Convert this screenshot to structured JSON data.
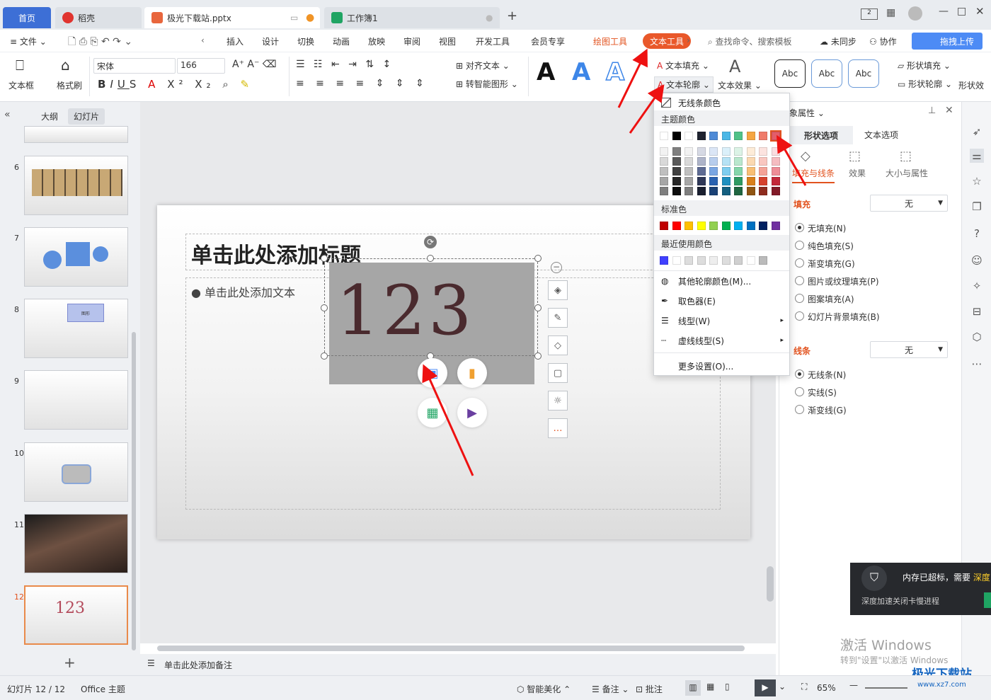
{
  "tabs": {
    "home": "首页",
    "docer": "稻壳",
    "ppt": "极光下载站.pptx",
    "sheet": "工作簿1",
    "new": "+"
  },
  "menu": {
    "items": [
      "文件",
      "插入",
      "设计",
      "切换",
      "动画",
      "放映",
      "审阅",
      "视图",
      "开发工具",
      "会员专享"
    ],
    "drawing_tools": "绘图工具",
    "text_tools": "文本工具",
    "search": "查找命令、搜索模板",
    "unsync": "未同步",
    "collab": "协作",
    "upload": "拖拽上传"
  },
  "ribbon": {
    "textbox": "文本框",
    "format_painter": "格式刷",
    "font": "宋体",
    "size": "166",
    "align_text": "对齐文本",
    "smart_shape": "转智能图形",
    "text_fill": "文本填充",
    "text_outline": "文本轮廓",
    "text_effect": "文本效果",
    "style_samples": [
      "Abc",
      "Abc",
      "Abc"
    ],
    "shape_fill": "形状填充",
    "shape_outline": "形状轮廓",
    "shape_effect": "形状效"
  },
  "left_panel": {
    "outline_tab": "大纲",
    "slides_tab": "幻灯片",
    "numbers": [
      "6",
      "7",
      "8",
      "9",
      "10",
      "11",
      "12"
    ],
    "thumb8_text": "图形",
    "thumb12_text": "123"
  },
  "slide": {
    "title": "单击此处添加标题",
    "body": "单击此处添加文本",
    "big_text": "123",
    "notes": "单击此处添加备注"
  },
  "dropdown": {
    "no_outline": "无线条颜色",
    "theme_colors": "主题颜色",
    "standard_colors": "标准色",
    "recent_colors": "最近使用颜色",
    "more_colors": "其他轮廓颜色(M)...",
    "eyedropper": "取色器(E)",
    "line_type": "线型(W)",
    "dash_type": "虚线线型(S)",
    "more_settings": "更多设置(O)...",
    "theme_row": [
      "#ffffff",
      "#000000",
      "#ffffff",
      "#1f2330",
      "#4e8ad6",
      "#4bb7e6",
      "#50c288",
      "#f5a542",
      "#ef7b6a",
      "#e35d6a"
    ],
    "shade_rows": [
      [
        "#f2f2f2",
        "#7f7f7f",
        "#f2f2f2",
        "#d6d9e4",
        "#dbe6f6",
        "#dbf0fa",
        "#dcf3e6",
        "#fdecd8",
        "#fce3df",
        "#fadde0"
      ],
      [
        "#d9d9d9",
        "#595959",
        "#d9d9d9",
        "#aeb4c9",
        "#b7cded",
        "#b6e2f5",
        "#b9e7cd",
        "#fbd9b1",
        "#f9c7c0",
        "#f5bcc1"
      ],
      [
        "#bfbfbf",
        "#404040",
        "#bfbfbf",
        "#5e6b93",
        "#7aa6e2",
        "#7ecdef",
        "#85d6aa",
        "#f8bf75",
        "#f4a397",
        "#ee8d97"
      ],
      [
        "#a6a6a6",
        "#262626",
        "#a6a6a6",
        "#2f3858",
        "#2a62b0",
        "#1f8fc0",
        "#2f9a62",
        "#d9801c",
        "#d5422d",
        "#c3283a"
      ],
      [
        "#7f7f7f",
        "#0d0d0d",
        "#7f7f7f",
        "#1a1f30",
        "#1b4175",
        "#145f80",
        "#1f6641",
        "#905512",
        "#8e2c1e",
        "#821a27"
      ]
    ],
    "standard_row": [
      "#c00000",
      "#ff0000",
      "#ffc000",
      "#ffff00",
      "#92d050",
      "#00b050",
      "#00b0f0",
      "#0070c0",
      "#002060",
      "#7030a0"
    ],
    "recent_row": [
      "#4040ff",
      "#ffffff",
      "#dddddd",
      "#dddddd",
      "#eeeeee",
      "#dddddd",
      "#d0d0d0",
      "#ffffff",
      "#bbbbbb"
    ]
  },
  "right_panel": {
    "title": "象属性",
    "shape_options": "形状选项",
    "text_options": "文本选项",
    "fill_line": "填充与线条",
    "effect": "效果",
    "size_props": "大小与属性",
    "fill_header": "填充",
    "fill_value": "无",
    "fill_opts": [
      "无填充(N)",
      "纯色填充(S)",
      "渐变填充(G)",
      "图片或纹理填充(P)",
      "图案填充(A)",
      "幻灯片背景填充(B)"
    ],
    "line_header": "线条",
    "line_value": "无",
    "line_opts": [
      "无线条(N)",
      "实线(S)",
      "渐变线(G)"
    ]
  },
  "toast": {
    "title": "内存已超标，需要",
    "action": "深度",
    "sub": "深度加速关闭卡慢进程"
  },
  "watermark": {
    "line1": "激活 Windows",
    "line2": "转到\"设置\"以激活 Windows"
  },
  "logo": {
    "name": "极光下载站",
    "url": "www.xz7.com"
  },
  "status": {
    "slide_count": "幻灯片 12 / 12",
    "theme": "Office 主题",
    "beautify": "智能美化",
    "notes": "备注",
    "comment": "批注",
    "zoom": "65%"
  }
}
